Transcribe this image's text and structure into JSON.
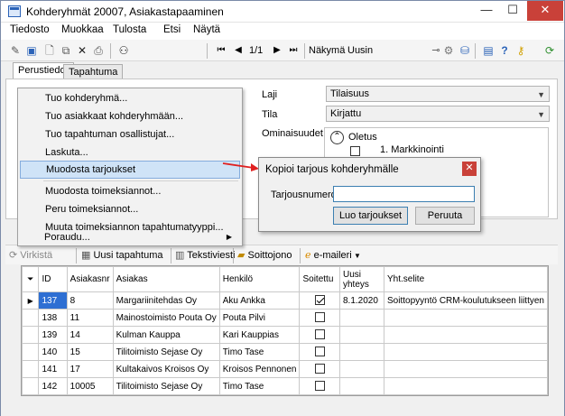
{
  "window": {
    "title": "Kohderyhmät 20007, Asiakastapaaminen",
    "minimize": "—",
    "maximize": "☐",
    "close": "✕"
  },
  "menubar": [
    "Tiedosto",
    "Muokkaa",
    "Tulosta",
    "Etsi",
    "Näytä"
  ],
  "toolbar": {
    "page": "1/1",
    "view_label": "Näkymä",
    "view_value": "Uusin"
  },
  "tabs": [
    "Perustiedot",
    "Tapahtuma"
  ],
  "form": {
    "laji_label": "Laji",
    "laji_value": "Tilaisuus",
    "tila_label": "Tila",
    "tila_value": "Kirjattu",
    "ominaisuudet_label": "Ominaisuudet",
    "tree_root": "Oletus",
    "tree_child": "1. Markkinointi"
  },
  "context_menu": {
    "items": [
      "Tuo kohderyhmä...",
      "Tuo asiakkaat kohderyhmään...",
      "Tuo tapahtuman osallistujat...",
      "Laskuta...",
      "Muodosta tarjoukset",
      "Muodosta toimeksiannot...",
      "Peru toimeksiannot...",
      "Muuta toimeksiannon tapahtumatyyppi...",
      "Poraudu..."
    ],
    "highlighted": 4
  },
  "dialog": {
    "title": "Kopioi tarjous kohderyhmälle",
    "field_label": "Tarjousnumero",
    "field_value": "",
    "ok": "Luo tarjoukset",
    "cancel": "Peruuta"
  },
  "grid_toolbar": {
    "refresh": "Virkistä",
    "new_event": "Uusi tapahtuma",
    "sms": "Tekstiviesti",
    "call_queue": "Soittojono",
    "email": "e-maileri"
  },
  "grid": {
    "columns": [
      "ID",
      "Asiakasnr",
      "Asiakas",
      "Henkilö",
      "Soitettu",
      "Uusi yhteys",
      "Yht.selite"
    ],
    "rows": [
      {
        "id": "137",
        "nr": "8",
        "asiakas": "Margariinitehdas Oy",
        "henkilo": "Aku Ankka",
        "soitettu": true,
        "yhteys": "8.1.2020",
        "selite": "Soittopyyntö CRM-koulutukseen liittyen"
      },
      {
        "id": "138",
        "nr": "11",
        "asiakas": "Mainostoimisto Pouta Oy",
        "henkilo": "Pouta Pilvi",
        "soitettu": false,
        "yhteys": "",
        "selite": ""
      },
      {
        "id": "139",
        "nr": "14",
        "asiakas": "Kulman Kauppa",
        "henkilo": "Kari Kauppias",
        "soitettu": false,
        "yhteys": "",
        "selite": ""
      },
      {
        "id": "140",
        "nr": "15",
        "asiakas": "Tilitoimisto Sejase Oy",
        "henkilo": "Timo Tase",
        "soitettu": false,
        "yhteys": "",
        "selite": ""
      },
      {
        "id": "141",
        "nr": "17",
        "asiakas": "Kultakaivos Kroisos Oy",
        "henkilo": "Kroisos Pennonen",
        "soitettu": false,
        "yhteys": "",
        "selite": ""
      },
      {
        "id": "142",
        "nr": "10005",
        "asiakas": "Tilitoimisto Sejase Oy",
        "henkilo": "Timo Tase",
        "soitettu": false,
        "yhteys": "",
        "selite": ""
      }
    ]
  },
  "colors": {
    "accent": "#2e6fd3",
    "close": "#c94139",
    "arrow": "#e02020"
  }
}
